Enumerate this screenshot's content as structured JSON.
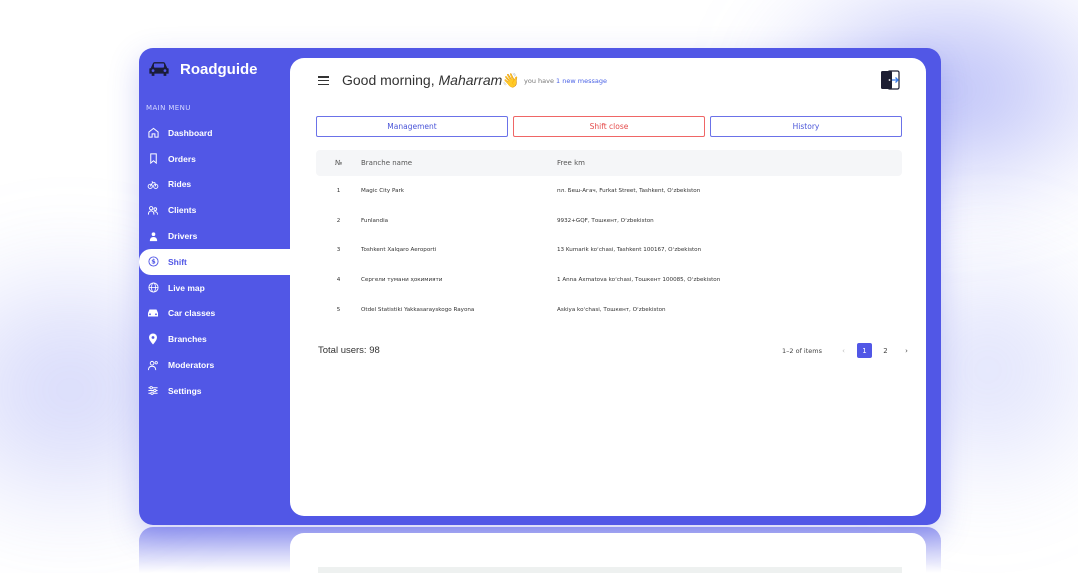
{
  "app": {
    "name": "Roadguide"
  },
  "sidebar": {
    "caption": "MAIN MENU",
    "items": [
      {
        "label": "Dashboard",
        "icon": "home-icon"
      },
      {
        "label": "Orders",
        "icon": "bookmark-icon"
      },
      {
        "label": "Rides",
        "icon": "bike-icon"
      },
      {
        "label": "Clients",
        "icon": "users-icon"
      },
      {
        "label": "Drivers",
        "icon": "driver-icon"
      },
      {
        "label": "Shift",
        "icon": "dollar-icon",
        "active": true
      },
      {
        "label": "Live map",
        "icon": "globe-icon"
      },
      {
        "label": "Car classes",
        "icon": "car-icon"
      },
      {
        "label": "Branches",
        "icon": "pin-icon"
      },
      {
        "label": "Moderators",
        "icon": "moderators-icon"
      },
      {
        "label": "Settings",
        "icon": "sliders-icon"
      }
    ]
  },
  "header": {
    "greeting": "Good morning,",
    "user_name": "Maharram",
    "wave": "👋",
    "message_prefix": "you have",
    "message_link": "1 new message"
  },
  "tabs": [
    {
      "label": "Management",
      "style": "primary"
    },
    {
      "label": "Shift close",
      "style": "danger"
    },
    {
      "label": "History",
      "style": "primary"
    }
  ],
  "table": {
    "columns": [
      "№",
      "Branche name",
      "Free km"
    ],
    "rows": [
      {
        "no": "1",
        "branch": "Magic City Park",
        "free_km": "пл. Беш-Агач, Furkat Street, Tashkent, Oʻzbekiston"
      },
      {
        "no": "2",
        "branch": "Funlandia",
        "free_km": "9932+GQF, Тошкент, Oʻzbekiston"
      },
      {
        "no": "3",
        "branch": "Toshkent Xalqaro Aeroporti",
        "free_km": "13 Kumarik koʻchasi, Tashkent 100167, Oʻzbekiston"
      },
      {
        "no": "4",
        "branch": "Сергели тумани ҳокимияти",
        "free_km": "1 Anna Axmatova koʻchasi, Тошкент 100085, Oʻzbekiston"
      },
      {
        "no": "5",
        "branch": "Otdel Statistiki Yakkasarayskogo Rayona",
        "free_km": "Askiya koʻchasi, Тошкент, Oʻzbekiston"
      }
    ]
  },
  "footer": {
    "total_label": "Total users: 98",
    "range": "1–2 of items",
    "prev": "‹",
    "pages": [
      "1",
      "2"
    ],
    "current_page": "1",
    "next": "›"
  },
  "colors": {
    "accent": "#5157e6",
    "danger": "#e54b4b",
    "link": "#4a62e6"
  }
}
